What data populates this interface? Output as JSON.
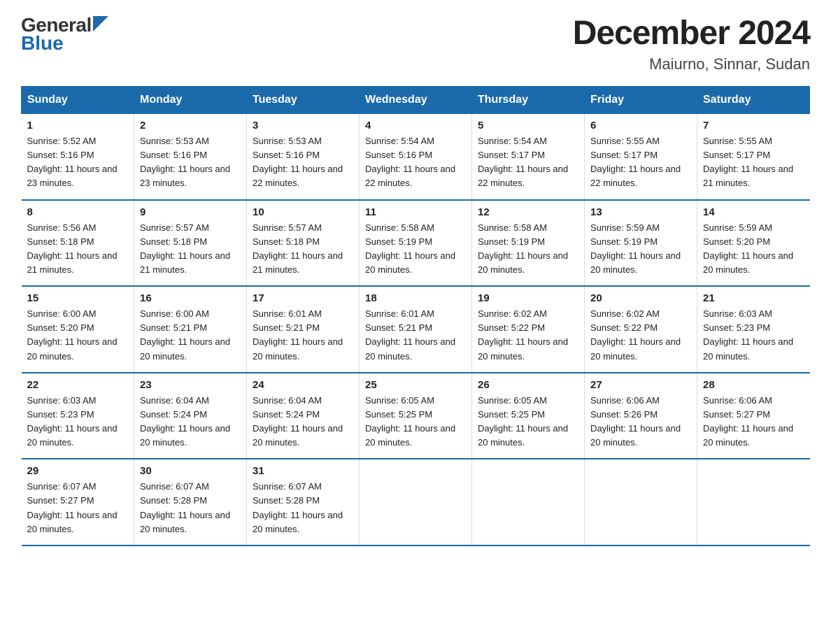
{
  "logo": {
    "general": "General",
    "blue": "Blue"
  },
  "title": "December 2024",
  "subtitle": "Maiurno, Sinnar, Sudan",
  "days_of_week": [
    "Sunday",
    "Monday",
    "Tuesday",
    "Wednesday",
    "Thursday",
    "Friday",
    "Saturday"
  ],
  "weeks": [
    [
      {
        "num": "1",
        "sunrise": "5:52 AM",
        "sunset": "5:16 PM",
        "daylight": "11 hours and 23 minutes."
      },
      {
        "num": "2",
        "sunrise": "5:53 AM",
        "sunset": "5:16 PM",
        "daylight": "11 hours and 23 minutes."
      },
      {
        "num": "3",
        "sunrise": "5:53 AM",
        "sunset": "5:16 PM",
        "daylight": "11 hours and 22 minutes."
      },
      {
        "num": "4",
        "sunrise": "5:54 AM",
        "sunset": "5:16 PM",
        "daylight": "11 hours and 22 minutes."
      },
      {
        "num": "5",
        "sunrise": "5:54 AM",
        "sunset": "5:17 PM",
        "daylight": "11 hours and 22 minutes."
      },
      {
        "num": "6",
        "sunrise": "5:55 AM",
        "sunset": "5:17 PM",
        "daylight": "11 hours and 22 minutes."
      },
      {
        "num": "7",
        "sunrise": "5:55 AM",
        "sunset": "5:17 PM",
        "daylight": "11 hours and 21 minutes."
      }
    ],
    [
      {
        "num": "8",
        "sunrise": "5:56 AM",
        "sunset": "5:18 PM",
        "daylight": "11 hours and 21 minutes."
      },
      {
        "num": "9",
        "sunrise": "5:57 AM",
        "sunset": "5:18 PM",
        "daylight": "11 hours and 21 minutes."
      },
      {
        "num": "10",
        "sunrise": "5:57 AM",
        "sunset": "5:18 PM",
        "daylight": "11 hours and 21 minutes."
      },
      {
        "num": "11",
        "sunrise": "5:58 AM",
        "sunset": "5:19 PM",
        "daylight": "11 hours and 20 minutes."
      },
      {
        "num": "12",
        "sunrise": "5:58 AM",
        "sunset": "5:19 PM",
        "daylight": "11 hours and 20 minutes."
      },
      {
        "num": "13",
        "sunrise": "5:59 AM",
        "sunset": "5:19 PM",
        "daylight": "11 hours and 20 minutes."
      },
      {
        "num": "14",
        "sunrise": "5:59 AM",
        "sunset": "5:20 PM",
        "daylight": "11 hours and 20 minutes."
      }
    ],
    [
      {
        "num": "15",
        "sunrise": "6:00 AM",
        "sunset": "5:20 PM",
        "daylight": "11 hours and 20 minutes."
      },
      {
        "num": "16",
        "sunrise": "6:00 AM",
        "sunset": "5:21 PM",
        "daylight": "11 hours and 20 minutes."
      },
      {
        "num": "17",
        "sunrise": "6:01 AM",
        "sunset": "5:21 PM",
        "daylight": "11 hours and 20 minutes."
      },
      {
        "num": "18",
        "sunrise": "6:01 AM",
        "sunset": "5:21 PM",
        "daylight": "11 hours and 20 minutes."
      },
      {
        "num": "19",
        "sunrise": "6:02 AM",
        "sunset": "5:22 PM",
        "daylight": "11 hours and 20 minutes."
      },
      {
        "num": "20",
        "sunrise": "6:02 AM",
        "sunset": "5:22 PM",
        "daylight": "11 hours and 20 minutes."
      },
      {
        "num": "21",
        "sunrise": "6:03 AM",
        "sunset": "5:23 PM",
        "daylight": "11 hours and 20 minutes."
      }
    ],
    [
      {
        "num": "22",
        "sunrise": "6:03 AM",
        "sunset": "5:23 PM",
        "daylight": "11 hours and 20 minutes."
      },
      {
        "num": "23",
        "sunrise": "6:04 AM",
        "sunset": "5:24 PM",
        "daylight": "11 hours and 20 minutes."
      },
      {
        "num": "24",
        "sunrise": "6:04 AM",
        "sunset": "5:24 PM",
        "daylight": "11 hours and 20 minutes."
      },
      {
        "num": "25",
        "sunrise": "6:05 AM",
        "sunset": "5:25 PM",
        "daylight": "11 hours and 20 minutes."
      },
      {
        "num": "26",
        "sunrise": "6:05 AM",
        "sunset": "5:25 PM",
        "daylight": "11 hours and 20 minutes."
      },
      {
        "num": "27",
        "sunrise": "6:06 AM",
        "sunset": "5:26 PM",
        "daylight": "11 hours and 20 minutes."
      },
      {
        "num": "28",
        "sunrise": "6:06 AM",
        "sunset": "5:27 PM",
        "daylight": "11 hours and 20 minutes."
      }
    ],
    [
      {
        "num": "29",
        "sunrise": "6:07 AM",
        "sunset": "5:27 PM",
        "daylight": "11 hours and 20 minutes."
      },
      {
        "num": "30",
        "sunrise": "6:07 AM",
        "sunset": "5:28 PM",
        "daylight": "11 hours and 20 minutes."
      },
      {
        "num": "31",
        "sunrise": "6:07 AM",
        "sunset": "5:28 PM",
        "daylight": "11 hours and 20 minutes."
      },
      null,
      null,
      null,
      null
    ]
  ],
  "labels": {
    "sunrise": "Sunrise:",
    "sunset": "Sunset:",
    "daylight": "Daylight:"
  }
}
